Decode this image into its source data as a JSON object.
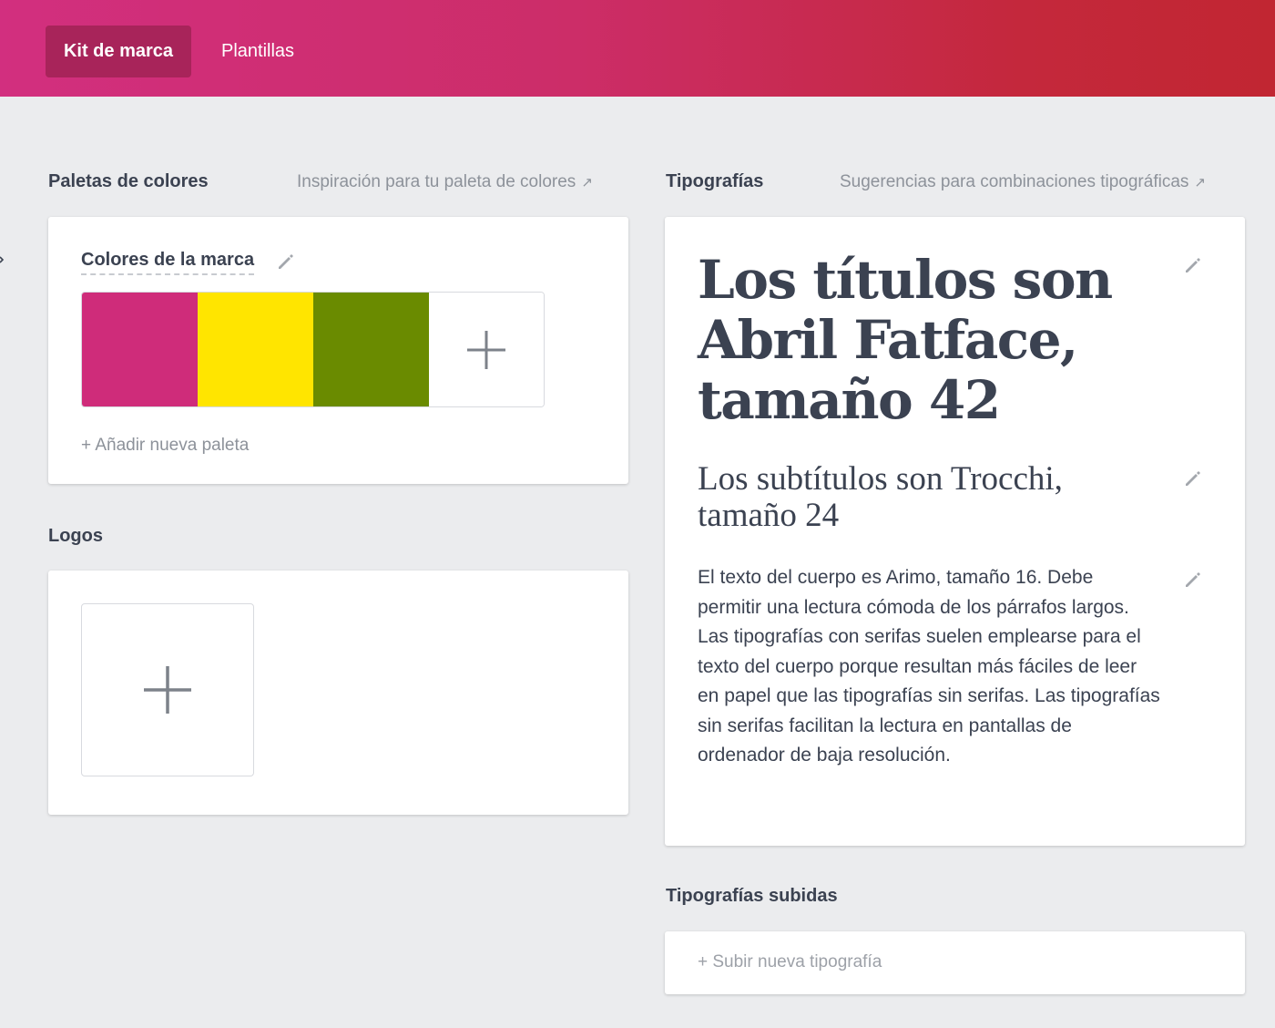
{
  "nav": {
    "tabs": [
      {
        "label": "Kit de marca",
        "active": true
      },
      {
        "label": "Plantillas",
        "active": false
      }
    ]
  },
  "palettes": {
    "title": "Paletas de colores",
    "link": "Inspiración para tu paleta de colores",
    "palette_name": "Colores de la marca",
    "colors": [
      "#cf2c7a",
      "#ffe500",
      "#6a8b00"
    ],
    "add_label": "+ Añadir nueva paleta"
  },
  "logos": {
    "title": "Logos"
  },
  "typography": {
    "title": "Tipografías",
    "link": "Sugerencias para combinaciones tipográficas",
    "heading": "Los títulos son Abril Fatface, tamaño 42",
    "subheading": "Los subtítulos son Trocchi, tamaño 24",
    "body": "El texto del cuerpo es Arimo, tamaño 16. Debe permitir una lectura cómoda de los párrafos largos. Las tipografías con serifas suelen emplearse para el texto del cuerpo porque resultan más fáciles de leer en papel que las tipografías sin serifas. Las tipografías sin serifas facilitan la lectura en pantallas de ordenador de baja resolución."
  },
  "uploaded_fonts": {
    "title": "Tipografías subidas",
    "add_label": "+ Subir nueva tipografía"
  },
  "icons": {
    "edit": "pencil-icon",
    "add": "plus-icon",
    "external": "arrow-up-right-icon"
  }
}
